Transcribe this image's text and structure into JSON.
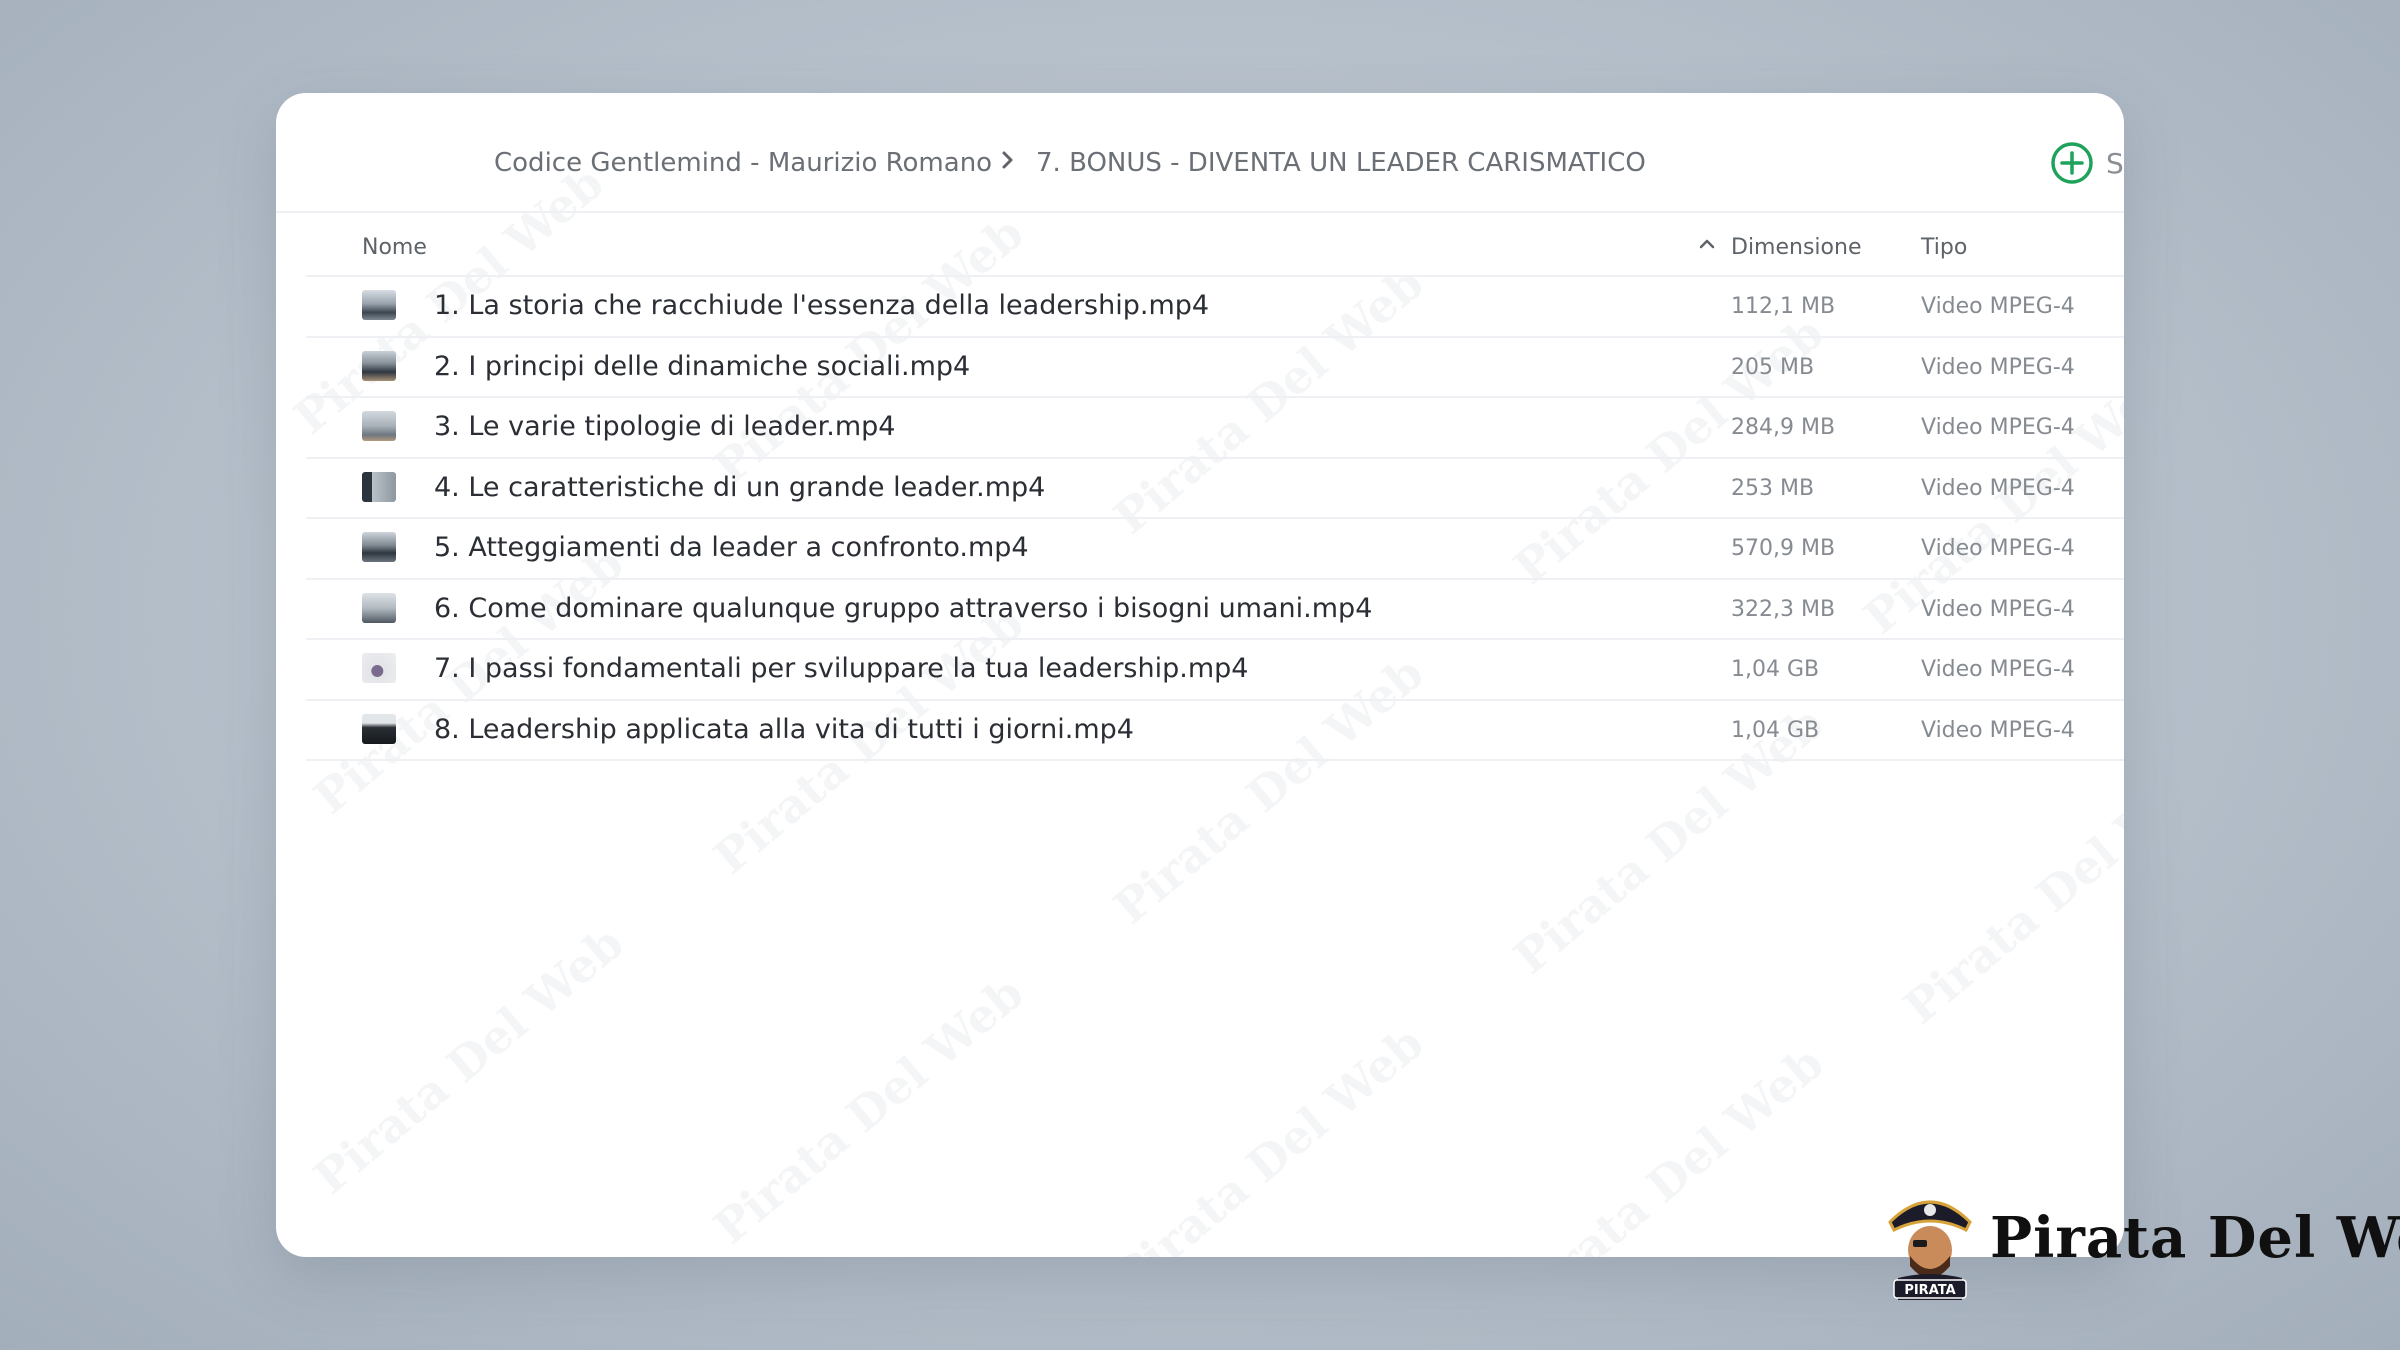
{
  "breadcrumb": {
    "root": "Codice Gentlemind - Maurizio Romano",
    "current": "7. BONUS - DIVENTA UN LEADER CARISMATICO"
  },
  "toolbar": {
    "add_label": "S"
  },
  "table": {
    "headers": {
      "name": "Nome",
      "size": "Dimensione",
      "type": "Tipo"
    },
    "sort": "ascending",
    "rows": [
      {
        "name": "1. La storia che racchiude l'essenza della leadership.mp4",
        "size": "112,1 MB",
        "type": "Video MPEG-4"
      },
      {
        "name": "2. I principi delle dinamiche sociali.mp4",
        "size": "205 MB",
        "type": "Video MPEG-4"
      },
      {
        "name": "3. Le varie tipologie di leader.mp4",
        "size": "284,9 MB",
        "type": "Video MPEG-4"
      },
      {
        "name": "4. Le caratteristiche di un grande leader.mp4",
        "size": "253 MB",
        "type": "Video MPEG-4"
      },
      {
        "name": "5. Atteggiamenti da leader a confronto.mp4",
        "size": "570,9 MB",
        "type": "Video MPEG-4"
      },
      {
        "name": "6. Come dominare qualunque gruppo attraverso i bisogni umani.mp4",
        "size": "322,3 MB",
        "type": "Video MPEG-4"
      },
      {
        "name": "7. I passi fondamentali per sviluppare la tua leadership.mp4",
        "size": "1,04 GB",
        "type": "Video MPEG-4"
      },
      {
        "name": "8. Leadership applicata alla vita di tutti i giorni.mp4",
        "size": "1,04 GB",
        "type": "Video MPEG-4"
      }
    ]
  },
  "watermark": {
    "text": "Pirata Del Web"
  },
  "logo": {
    "badge_text": "PIRATA",
    "brand": "Pirata Del Web"
  },
  "colors": {
    "accent_green": "#1fa35c",
    "text_primary": "#2b2f35",
    "text_muted": "#868b92"
  }
}
